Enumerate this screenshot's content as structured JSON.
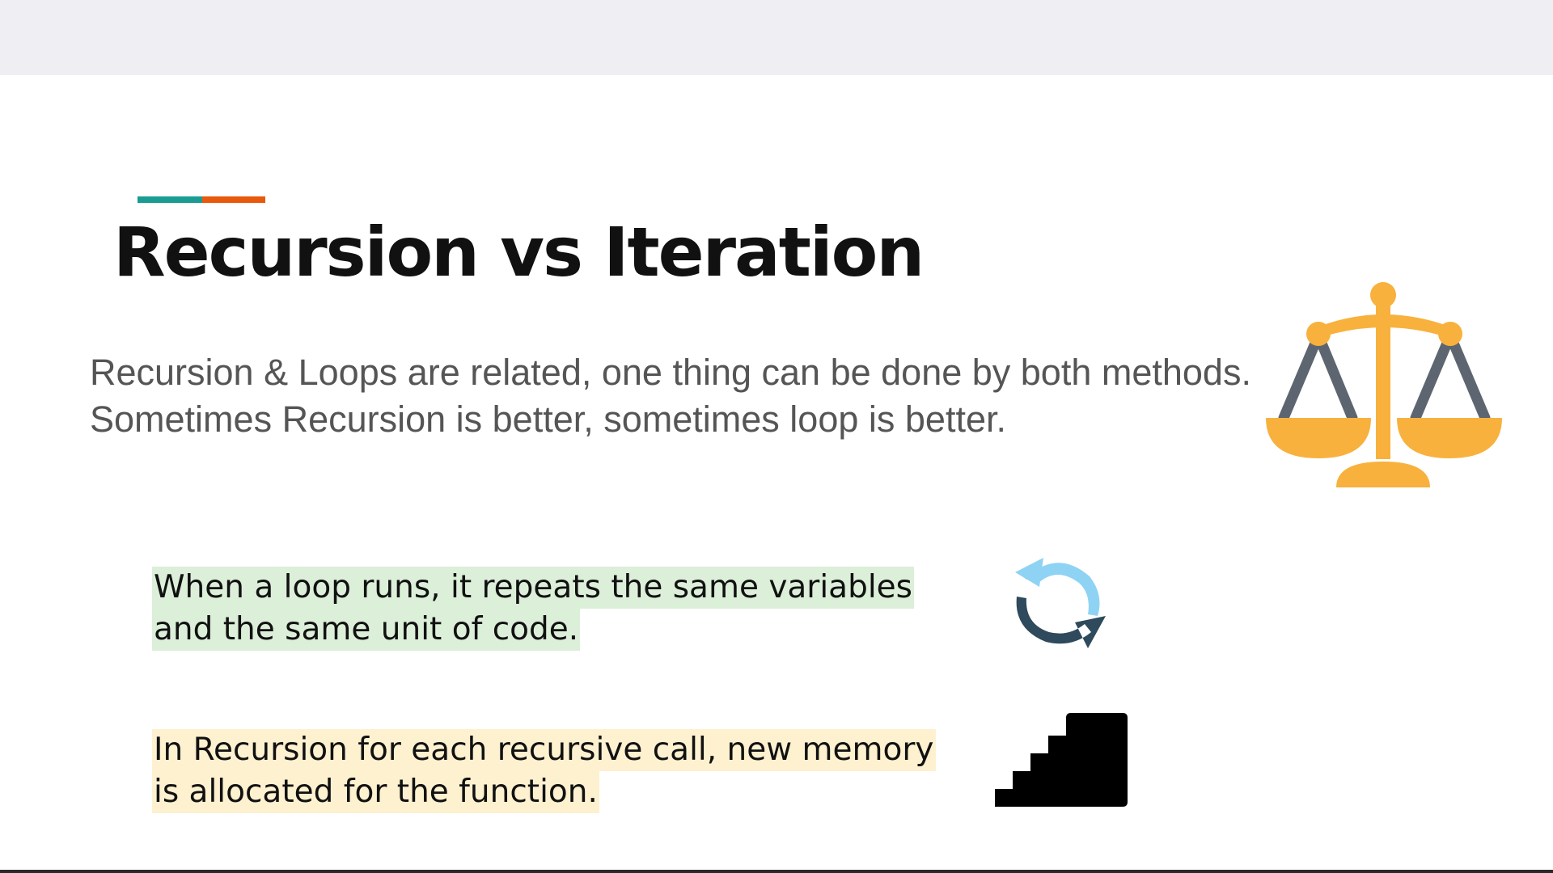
{
  "slide": {
    "title": "Recursion vs Iteration",
    "intro_lines": [
      "Recursion & Loops are related, one thing can be done by both methods.",
      "Sometimes Recursion is better, sometimes loop is better."
    ],
    "notes": [
      {
        "lines": [
          "When a loop runs, it repeats the same variables",
          "and the same unit of code."
        ],
        "highlight": "#dcefd9",
        "icon": "cycle-arrows-icon"
      },
      {
        "lines": [
          "In Recursion for each recursive call, new memory",
          "is allocated for the function."
        ],
        "highlight": "#fdf1d0",
        "icon": "stairs-icon"
      }
    ],
    "decorations": {
      "title_accent_colors": [
        "#1a9c93",
        "#e8590c"
      ],
      "side_icon": "balance-scales-icon"
    },
    "colors": {
      "scales": "#f8b13d",
      "scales_arms": "#5d6670",
      "cycle_light": "#8fd3f4",
      "cycle_dark": "#2e4a5c",
      "stairs": "#000000"
    }
  }
}
